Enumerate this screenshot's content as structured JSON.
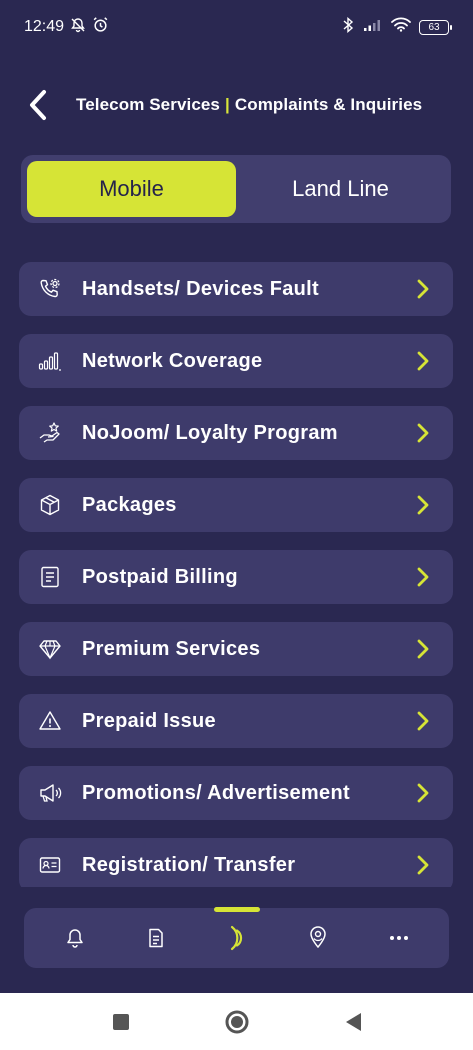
{
  "status_bar": {
    "time": "12:49",
    "battery": "63",
    "icons": [
      "bell-off-icon",
      "alarm-icon",
      "bluetooth-icon",
      "signal-icon",
      "wifi-icon",
      "battery-icon"
    ]
  },
  "header": {
    "title_part1": "Telecom Services",
    "separator": "|",
    "title_part2": "Complaints & Inquiries"
  },
  "toggle": {
    "mobile": "Mobile",
    "landline": "Land Line",
    "active": "mobile"
  },
  "menu": {
    "items": [
      {
        "label": "Handsets/ Devices Fault",
        "icon": "phone-settings-icon"
      },
      {
        "label": "Network Coverage",
        "icon": "signal-bars-icon"
      },
      {
        "label": "NoJoom/ Loyalty Program",
        "icon": "hand-star-icon"
      },
      {
        "label": "Packages",
        "icon": "box-icon"
      },
      {
        "label": "Postpaid Billing",
        "icon": "receipt-icon"
      },
      {
        "label": "Premium Services",
        "icon": "diamond-icon"
      },
      {
        "label": "Prepaid Issue",
        "icon": "warning-icon"
      },
      {
        "label": "Promotions/ Advertisement",
        "icon": "megaphone-icon"
      },
      {
        "label": "Registration/ Transfer",
        "icon": "id-card-icon"
      }
    ]
  },
  "bottom_nav": {
    "items": [
      "bell-icon",
      "document-icon",
      "signal-wave-icon",
      "location-pin-icon",
      "more-icon"
    ],
    "active": "signal-wave-icon"
  },
  "colors": {
    "background": "#2a2851",
    "card": "#3e3b6b",
    "accent": "#d6e436"
  }
}
